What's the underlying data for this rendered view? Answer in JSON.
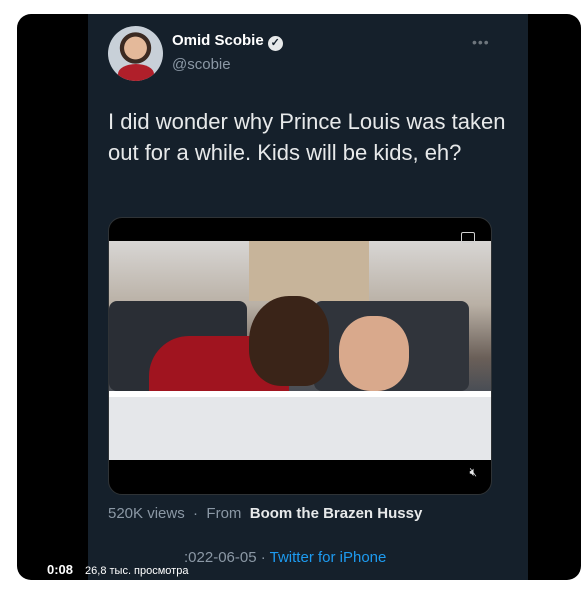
{
  "tweet": {
    "display_name": "Omid Scobie",
    "verified_icon": "verified-badge",
    "handle": "@scobie",
    "more_icon": "ellipsis-icon",
    "text": "I did wonder why Prince Louis was taken out for a while. Kids will be kids, eh?",
    "views_label": "520K views",
    "from_prefix": "From",
    "from_name": "Boom the Brazen Hussy",
    "date": "2022-06-05",
    "date_visible": ":022-06-05",
    "separator": "·",
    "source": "Twitter for iPhone"
  },
  "video_overlay": {
    "time": "0:08",
    "views": "26,8 тыс. просмотра"
  },
  "icons": {
    "captions": "closed-captions-icon",
    "mute": "muted-speaker-icon"
  },
  "colors": {
    "background": "#15202b",
    "accent": "#1d9bf0",
    "text": "#e7e9ea",
    "secondary": "#8b98a5"
  }
}
